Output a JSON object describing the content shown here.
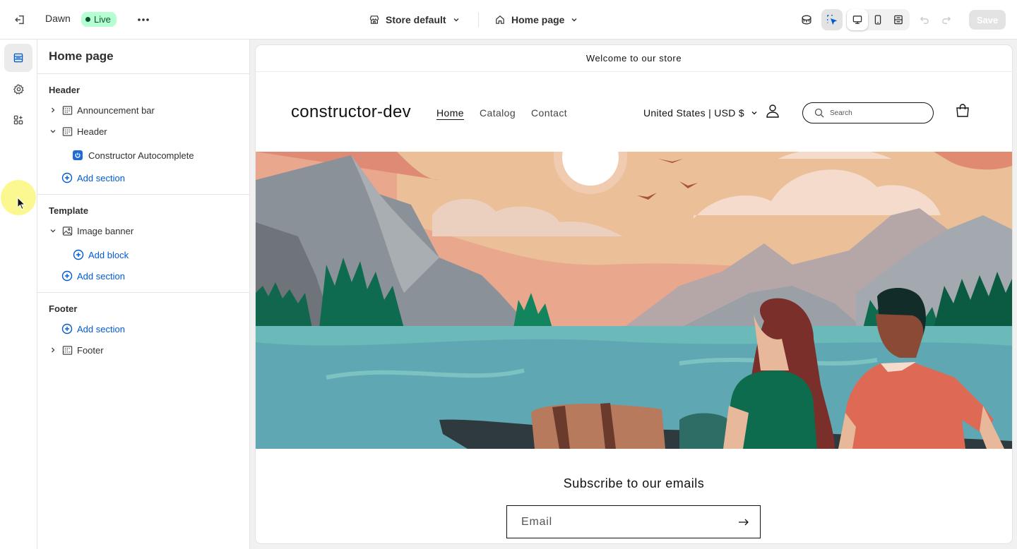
{
  "topbar": {
    "theme_name": "Dawn",
    "status_badge": "Live",
    "store_selector": "Store default",
    "page_selector": "Home page",
    "save_label": "Save"
  },
  "sidebar": {
    "title": "Home page",
    "header_group": {
      "label": "Header",
      "items": [
        {
          "label": "Announcement bar",
          "expanded": false
        },
        {
          "label": "Header",
          "expanded": true,
          "children": [
            "Constructor Autocomplete"
          ]
        }
      ],
      "add_section": "Add section"
    },
    "template_group": {
      "label": "Template",
      "items": [
        {
          "label": "Image banner",
          "expanded": true
        }
      ],
      "add_block": "Add block",
      "add_section": "Add section"
    },
    "footer_group": {
      "label": "Footer",
      "add_section": "Add section",
      "items": [
        {
          "label": "Footer",
          "expanded": false
        }
      ]
    }
  },
  "preview": {
    "announcement": "Welcome to our store",
    "logo": "constructor-dev",
    "nav": [
      "Home",
      "Catalog",
      "Contact"
    ],
    "active_nav": "Home",
    "locale": "United States | USD $",
    "search_placeholder": "Search",
    "subscribe_title": "Subscribe to our emails",
    "email_placeholder": "Email"
  },
  "colors": {
    "accent_blue": "#005bd3",
    "live_badge_bg": "#b4fed2",
    "live_badge_text": "#0c5132",
    "cursor_highlight": "#faf56e"
  },
  "icons": {
    "exit": "exit-icon",
    "more": "more-horizontal-icon",
    "store": "store-icon",
    "home": "home-icon",
    "sections": "sections-icon",
    "settings": "gear-icon",
    "apps": "apps-icon",
    "inspector": "inspector-icon",
    "desktop": "desktop-icon",
    "mobile": "mobile-icon",
    "fullwidth": "fullwidth-icon",
    "undo": "undo-icon",
    "redo": "redo-icon",
    "account": "account-icon",
    "cart": "cart-icon",
    "search": "search-icon",
    "arrow": "arrow-right-icon"
  }
}
